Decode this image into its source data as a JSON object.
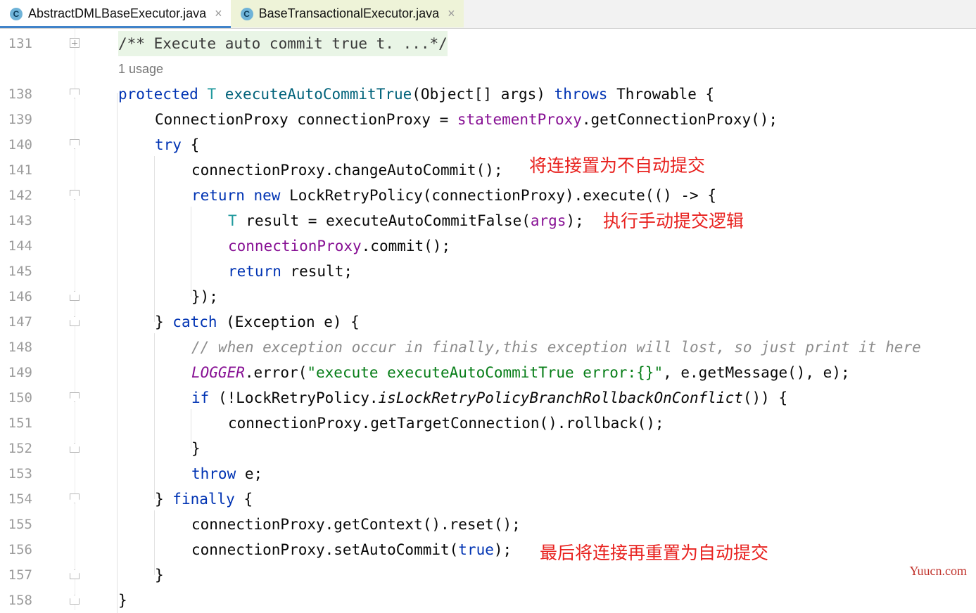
{
  "tabs": [
    {
      "label": "AbstractDMLBaseExecutor.java",
      "icon": "class-icon",
      "icon_letter": "C",
      "active": true
    },
    {
      "label": "BaseTransactionalExecutor.java",
      "icon": "class-icon",
      "icon_letter": "C",
      "active": false
    }
  ],
  "close_glyph": "×",
  "lines": {
    "131": "131",
    "138": "138",
    "139": "139",
    "140": "140",
    "141": "141",
    "142": "142",
    "143": "143",
    "144": "144",
    "145": "145",
    "146": "146",
    "147": "147",
    "148": "148",
    "149": "149",
    "150": "150",
    "151": "151",
    "152": "152",
    "153": "153",
    "154": "154",
    "155": "155",
    "156": "156",
    "157": "157",
    "158": "158"
  },
  "code": {
    "doc": "/** Execute auto commit true t. ...*/",
    "usage": "1 usage",
    "l138": {
      "kw": "protected",
      "type": "T",
      "fn": "executeAutoCommitTrue",
      "params": "(Object[] args) ",
      "throws": "throws",
      "rest": " Throwable {"
    },
    "l139": {
      "pre": "ConnectionProxy connectionProxy = ",
      "field": "statementProxy",
      "post": ".getConnectionProxy();"
    },
    "l140": {
      "kw": "try",
      "post": " {"
    },
    "l141": "connectionProxy.changeAutoCommit();",
    "l142": {
      "kw1": "return",
      "kw2": "new",
      "post": " LockRetryPolicy(connectionProxy).execute(() -> {"
    },
    "l143": {
      "type": "T",
      "pre": " result = executeAutoCommitFalse(",
      "field": "args",
      "post": ");"
    },
    "l144": {
      "field": "connectionProxy",
      "post": ".commit();"
    },
    "l145": {
      "kw": "return",
      "post": " result;"
    },
    "l146": "});",
    "l147": {
      "pre": "} ",
      "kw": "catch",
      "post": " (Exception e) {"
    },
    "l148": "// when exception occur in finally,this exception will lost, so just print it here",
    "l149": {
      "field": "LOGGER",
      "mid": ".error(",
      "str": "\"execute executeAutoCommitTrue error:{}\"",
      "post": ", e.getMessage(), e);"
    },
    "l150": {
      "kw": "if",
      "pre": " (!LockRetryPolicy.",
      "ital": "isLockRetryPolicyBranchRollbackOnConflict",
      "post": "()) {"
    },
    "l151": "connectionProxy.getTargetConnection().rollback();",
    "l152": "}",
    "l153": {
      "kw": "throw",
      "post": " e;"
    },
    "l154": {
      "pre": "} ",
      "kw": "finally",
      "post": " {"
    },
    "l155": "connectionProxy.getContext().reset();",
    "l156": {
      "pre": "connectionProxy.setAutoCommit(",
      "kw": "true",
      "post": ");"
    },
    "l157": "}",
    "l158": "}"
  },
  "annotations": {
    "a141": "将连接置为不自动提交",
    "a143": "执行手动提交逻辑",
    "a156": "最后将连接再重置为自动提交"
  },
  "watermark": "Yuucn.com",
  "colors": {
    "keyword": "#0033b3",
    "type_param": "#20999d",
    "method_decl": "#00627a",
    "field": "#871094",
    "string": "#067d17",
    "comment": "#8c8c8c",
    "annotation": "#e8221f",
    "active_tab_underline": "#4083c9"
  }
}
